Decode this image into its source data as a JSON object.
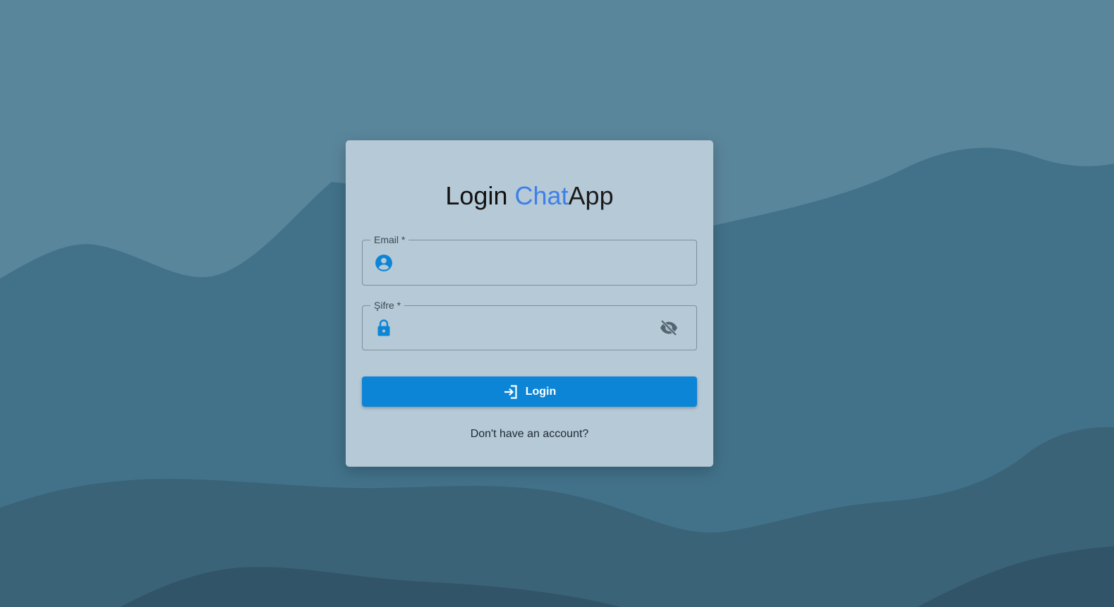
{
  "page": {
    "background_color": "#5a869c"
  },
  "login_card": {
    "title_prefix": "Login ",
    "title_accent": "Chat",
    "title_suffix": "App",
    "accent_color": "#3f7fe8"
  },
  "email_field": {
    "label": "Email *",
    "value": "",
    "icon": "account-circle-icon"
  },
  "password_field": {
    "label": "Şifre *",
    "value": "",
    "icon": "lock-icon",
    "toggle_icon": "visibility-off-icon"
  },
  "login_button": {
    "label": "Login",
    "icon": "login-arrow-icon",
    "color": "#0d85d6"
  },
  "signup_link": {
    "text": "Don't have an account?"
  }
}
